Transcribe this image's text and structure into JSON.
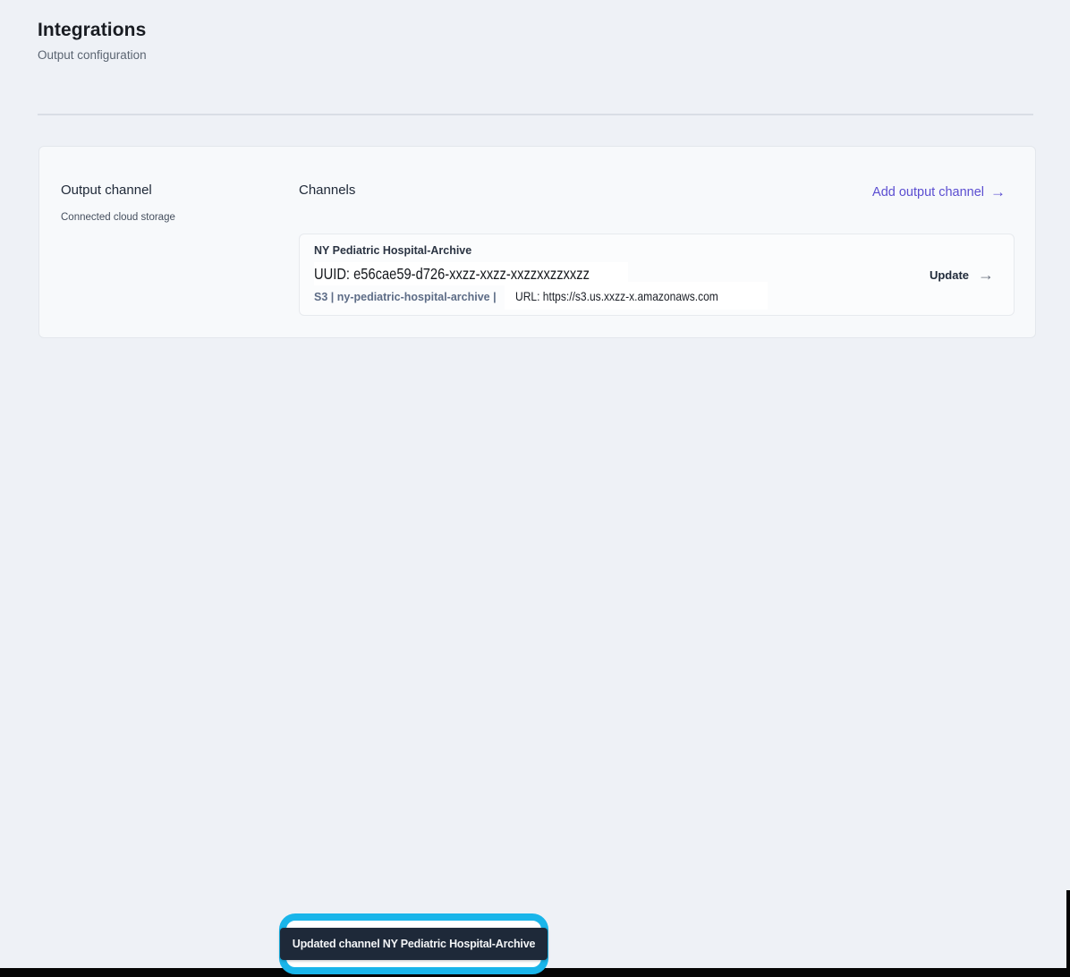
{
  "page": {
    "title": "Integrations",
    "subtitle": "Output configuration"
  },
  "panel": {
    "section_title": "Output channel",
    "section_subtitle": "Connected cloud storage",
    "channels_heading": "Channels",
    "add_link_label": "Add output channel"
  },
  "channel": {
    "name": "NY Pediatric Hospital-Archive",
    "uuid_label": "UUID: e56cae59-d726-xxzz-xxzz-xxzzxxzzxxzz",
    "storage_label": "S3 | ny-pediatric-hospital-archive |",
    "url_label": "URL: https://s3.us.xxzz-x.amazonaws.com",
    "update_label": "Update"
  },
  "toast": {
    "message": "Updated channel NY Pediatric Hospital-Archive"
  },
  "icons": {
    "arrow_right": "→"
  },
  "colors": {
    "accent_purple": "#5b4ed1",
    "highlight_cyan": "#19b5ea",
    "toast_bg": "#1e2939",
    "page_bg": "#eef1f6"
  }
}
